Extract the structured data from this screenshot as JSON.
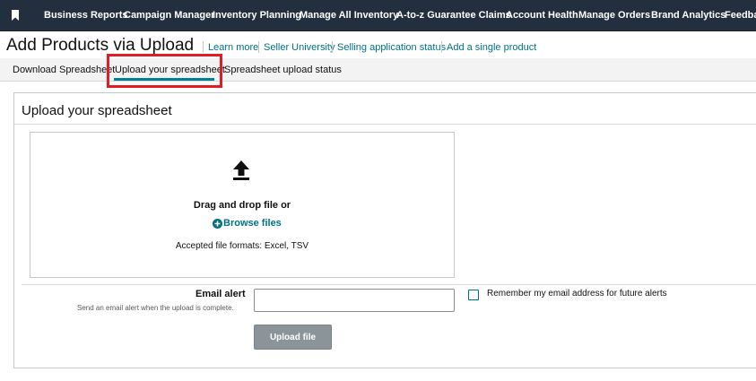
{
  "topnav": {
    "items": [
      "Business Reports",
      "Campaign Manager",
      "Inventory Planning",
      "Manage All Inventory",
      "A-to-z Guarantee Claims",
      "Account Health",
      "Manage Orders",
      "Brand Analytics",
      "Feedback"
    ],
    "icon": "bookmark-icon"
  },
  "header": {
    "title": "Add Products via Upload",
    "links": [
      "Learn more",
      "Seller University",
      "Selling application status",
      "Add a single product"
    ]
  },
  "tabs": [
    "Download Spreadsheet",
    "Upload your spreadsheet",
    "Spreadsheet upload status"
  ],
  "upload_panel": {
    "title": "Upload your spreadsheet",
    "drop_text": "Drag and drop file or",
    "browse_label": "Browse files",
    "formats_text": "Accepted file formats: Excel, TSV",
    "upload_icon": "upload-arrow-icon"
  },
  "email": {
    "label": "Email alert",
    "help": "Send an email alert when the upload is complete.",
    "value": "",
    "placeholder": "",
    "remember_label": "Remember my email address for future alerts"
  },
  "upload_button": "Upload file",
  "colors": {
    "nav_bg": "#232f3e",
    "link": "#007185",
    "active_tab": "#008296",
    "highlight": "#e31b23",
    "button_disabled": "#8a9499"
  }
}
